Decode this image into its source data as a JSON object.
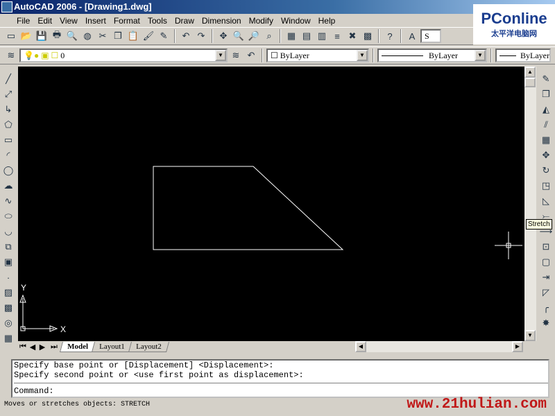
{
  "window": {
    "title": "AutoCAD 2006 - [Drawing1.dwg]"
  },
  "menu": [
    "File",
    "Edit",
    "View",
    "Insert",
    "Format",
    "Tools",
    "Draw",
    "Dimension",
    "Modify",
    "Window",
    "Help"
  ],
  "standard_toolbar": [
    "new",
    "open",
    "save",
    "plot",
    "plot-preview",
    "publish",
    "cut",
    "copy",
    "paste",
    "match-properties",
    "block-editor",
    "|",
    "undo",
    "redo",
    "|",
    "pan",
    "zoom-realtime",
    "zoom-window",
    "zoom-previous",
    "|",
    "properties",
    "design-center",
    "tool-palettes",
    "sheet-set",
    "markup",
    "calculator",
    "|",
    "help",
    "|",
    "text-style"
  ],
  "text_style_value": "S",
  "layers": {
    "current_layer": "0",
    "color": "ByLayer",
    "linetype": "ByLayer",
    "lineweight": "ByLayer"
  },
  "draw_toolbar": [
    "line",
    "construction-line",
    "polyline",
    "polygon",
    "rectangle",
    "arc",
    "circle",
    "revision-cloud",
    "spline",
    "ellipse",
    "ellipse-arc",
    "insert-block",
    "make-block",
    "point",
    "hatch",
    "gradient",
    "region",
    "table"
  ],
  "modify_toolbar": [
    "erase",
    "copy-object",
    "mirror",
    "offset",
    "array",
    "move",
    "rotate",
    "scale",
    "stretch",
    "trim",
    "extend",
    "break-at-point",
    "break",
    "join",
    "chamfer",
    "fillet",
    "explode"
  ],
  "tooltip": "Stretch",
  "ucs": {
    "x": "X",
    "y": "Y"
  },
  "tabs": [
    {
      "label": "Model",
      "active": true
    },
    {
      "label": "Layout1"
    },
    {
      "label": "Layout2"
    }
  ],
  "command": {
    "history": [
      "Specify base point or [Displacement] <Displacement>:",
      "Specify second point or <use first point as displacement>:"
    ],
    "prompt": "Command:"
  },
  "status": "Moves or stretches objects:  STRETCH",
  "watermark": "www.21hulian.com",
  "logo": {
    "brand": "PConline",
    "sub": "太平洋电脑网"
  },
  "colors": {
    "canvas": "#000000",
    "geometry": "#ffffff",
    "title_bar": "#0a246a",
    "watermark": "#c01818"
  }
}
